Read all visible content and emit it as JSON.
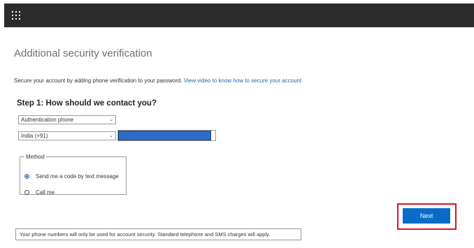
{
  "header": {
    "app_launcher_icon": "waffle-grid-icon",
    "background": "#2b2b2b"
  },
  "page": {
    "title": "Additional security verification",
    "intro_text": "Secure your account by adding phone verification to your password.",
    "intro_link": "View video to know how to secure your account"
  },
  "step1": {
    "title": "Step 1: How should we contact you?",
    "contact_method": "Authentication phone",
    "country_code": "India (+91)",
    "phone_number_redacted": true
  },
  "method": {
    "legend": "Method",
    "options": [
      {
        "label": "Send me a code by text message",
        "checked": true
      },
      {
        "label": "Call me",
        "checked": false
      }
    ]
  },
  "actions": {
    "next_label": "Next",
    "next_color": "#0a6cc8",
    "highlight_color": "#e0141e"
  },
  "footer": {
    "notice": "Your phone numbers will only be used for account security. Standard telephone and SMS charges will apply."
  }
}
